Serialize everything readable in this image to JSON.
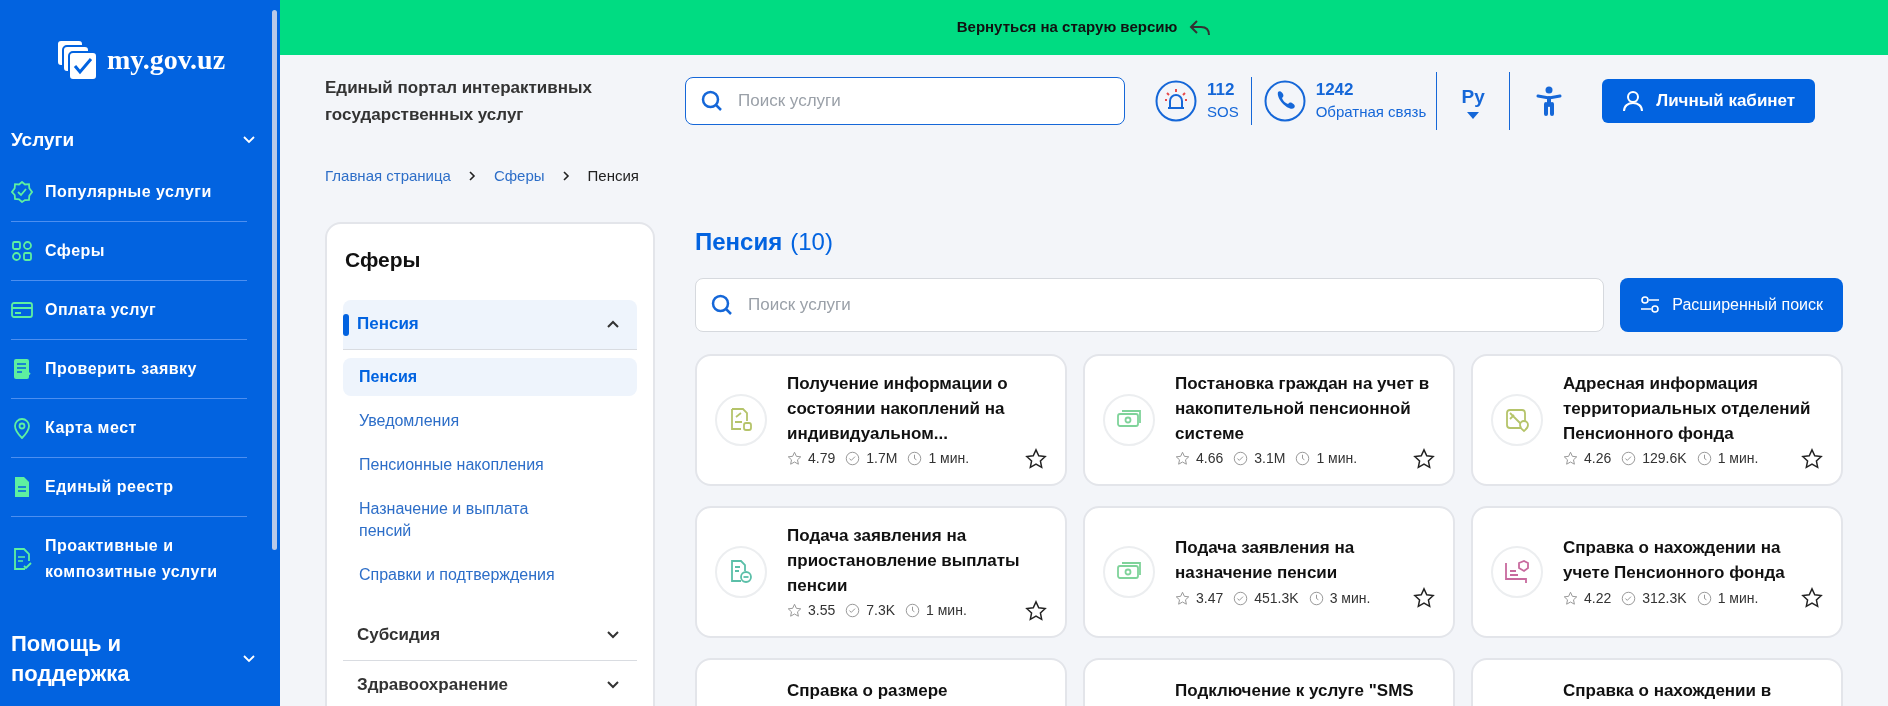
{
  "sidebar": {
    "logo": "my.gov.uz",
    "sections": [
      {
        "title": "Услуги",
        "items": [
          {
            "label": "Популярные услуги"
          },
          {
            "label": "Сферы"
          },
          {
            "label": "Оплата услуг"
          },
          {
            "label": "Проверить заявку"
          },
          {
            "label": "Карта мест"
          },
          {
            "label": "Единый реестр"
          },
          {
            "label": "Проактивные и композитные услуги"
          }
        ]
      },
      {
        "title": "Помощь и поддержка"
      }
    ]
  },
  "banner": {
    "text": "Вернуться на старую версию"
  },
  "header": {
    "title": "Единый портал интерактивных государственных услуг",
    "search": {
      "placeholder": "Поиск услуги"
    },
    "contacts": [
      {
        "kind": "sos",
        "number": "112",
        "label": "SOS"
      },
      {
        "kind": "phone",
        "number": "1242",
        "label": "Обратная связь"
      }
    ],
    "language": "Ру",
    "account_button": "Личный кабинет"
  },
  "breadcrumbs": [
    {
      "label": "Главная страница",
      "current": false
    },
    {
      "label": "Сферы",
      "current": false
    },
    {
      "label": "Пенсия",
      "current": true
    }
  ],
  "filter_panel": {
    "title": "Сферы",
    "groups": [
      {
        "label": "Пенсия",
        "expanded": true,
        "selected": true,
        "children": [
          {
            "label": "Пенсия",
            "selected": true
          },
          {
            "label": "Уведомления",
            "selected": false
          },
          {
            "label": "Пенсионные накопления",
            "selected": false
          },
          {
            "label": "Назначение и выплата пенсий",
            "selected": false
          },
          {
            "label": "Справки и подтверждения",
            "selected": false
          }
        ]
      },
      {
        "label": "Субсидия",
        "expanded": false,
        "selected": false
      },
      {
        "label": "Здравоохранение",
        "expanded": false,
        "selected": false
      }
    ]
  },
  "results": {
    "title": "Пенсия",
    "count": "(10)",
    "search": {
      "placeholder": "Поиск услуги"
    },
    "advanced_button": "Расширенный поиск",
    "cards": [
      {
        "title": "Получение информации о состоянии накоплений на индивидуальном...",
        "rating": "4.79",
        "uses": "1.7M",
        "time": "1 мин.",
        "color": "#b5c46a",
        "favorite": false
      },
      {
        "title": "Постановка граждан на учет в накопительной пенсионной системе",
        "rating": "4.66",
        "uses": "3.1M",
        "time": "1 мин.",
        "color": "#7fd39a",
        "favorite": false
      },
      {
        "title": "Адресная информация территориальных отделений Пенсионного фонда",
        "rating": "4.26",
        "uses": "129.6K",
        "time": "1 мин.",
        "color": "#b5c46a",
        "favorite": false
      },
      {
        "title": "Подача заявления на приостановление выплаты пенсии",
        "rating": "3.55",
        "uses": "7.3K",
        "time": "1 мин.",
        "color": "#5bbfa8",
        "favorite": false
      },
      {
        "title": "Подача заявления на назначение пенсии",
        "rating": "3.47",
        "uses": "451.3K",
        "time": "3 мин.",
        "color": "#7fd39a",
        "favorite": false
      },
      {
        "title": "Справка о нахождении на учете Пенсионного фонда",
        "rating": "4.22",
        "uses": "312.3K",
        "time": "1 мин.",
        "color": "#c86a9e",
        "favorite": false
      },
      {
        "title": "Справка о размере"
      },
      {
        "title": "Подключение к услуге \"SMS"
      },
      {
        "title": "Справка о нахождении в"
      }
    ]
  }
}
